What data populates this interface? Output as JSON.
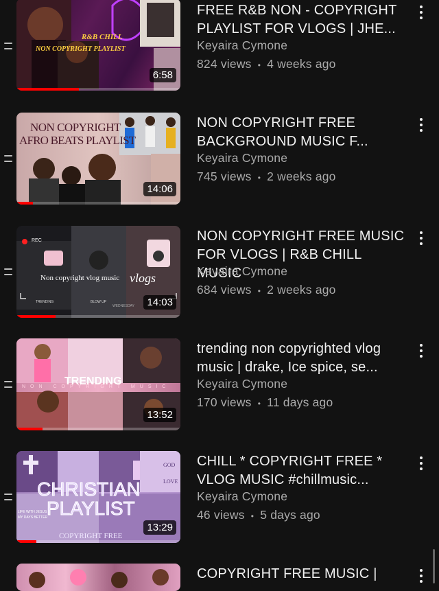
{
  "videos": [
    {
      "title": "FREE R&B NON - COPYRIGHT\nPLAYLIST FOR VLOGS | JHE...",
      "channel": "Keyaira Cymone",
      "views": "824 views",
      "age": "4 weeks ago",
      "duration": "6:58",
      "thumb_texts": [
        "R&B CHILL",
        "NON COPYRIGHT PLAYLIST"
      ],
      "watched_fraction": 0.38
    },
    {
      "title": "NON COPYRIGHT FREE\nBACKGROUND MUSIC F...",
      "channel": "Keyaira Cymone",
      "views": "745 views",
      "age": "2 weeks ago",
      "duration": "14:06",
      "thumb_texts": [
        "NON COPYRIGHT",
        "AFRO BEATS PLAYLIST"
      ],
      "watched_fraction": 0.1
    },
    {
      "title": "NON COPYRIGHT FREE MUSIC\nFOR VLOGS | R&B CHILL MUSIC",
      "channel": "Keyaira Cymone",
      "views": "684 views",
      "age": "2 weeks ago",
      "duration": "14:03",
      "thumb_texts": [
        "REC",
        "Non copyright vlog music",
        "vlogs",
        "TRENDING",
        "BLOW UP",
        "WEDNESDAY"
      ],
      "watched_fraction": 0.24
    },
    {
      "title": "trending non copyrighted vlog\nmusic |  drake, Ice spice, se...",
      "channel": "Keyaira Cymone",
      "views": "170 views",
      "age": "11 days ago",
      "duration": "13:52",
      "thumb_texts": [
        "TRENDING",
        "NON COPYRIGHT MUSIC"
      ],
      "watched_fraction": 0.16
    },
    {
      "title": "CHILL * COPYRIGHT FREE *\nVLOG MUSIC #chillmusic...",
      "channel": "Keyaira Cymone",
      "views": "46 views",
      "age": "5 days ago",
      "duration": "13:29",
      "thumb_texts": [
        "CHRISTIAN",
        "PLAYLIST",
        "COPYRIGHT FREE",
        "GOD",
        "LOVE",
        "LIFE WITH JESUS",
        "MY DAYS BETTER"
      ],
      "watched_fraction": 0.12
    },
    {
      "title": "COPYRIGHT FREE MUSIC  |",
      "channel": "",
      "views": "",
      "age": "",
      "duration": "",
      "thumb_texts": [],
      "watched_fraction": 0
    }
  ],
  "meta_separator": "•",
  "colors": {
    "background": "#121212",
    "title": "#f1f1f1",
    "secondary": "#aaaaaa",
    "progress": "#ff0000"
  },
  "icons": {
    "drag": "drag-handle-icon",
    "menu": "more-vert-icon"
  }
}
